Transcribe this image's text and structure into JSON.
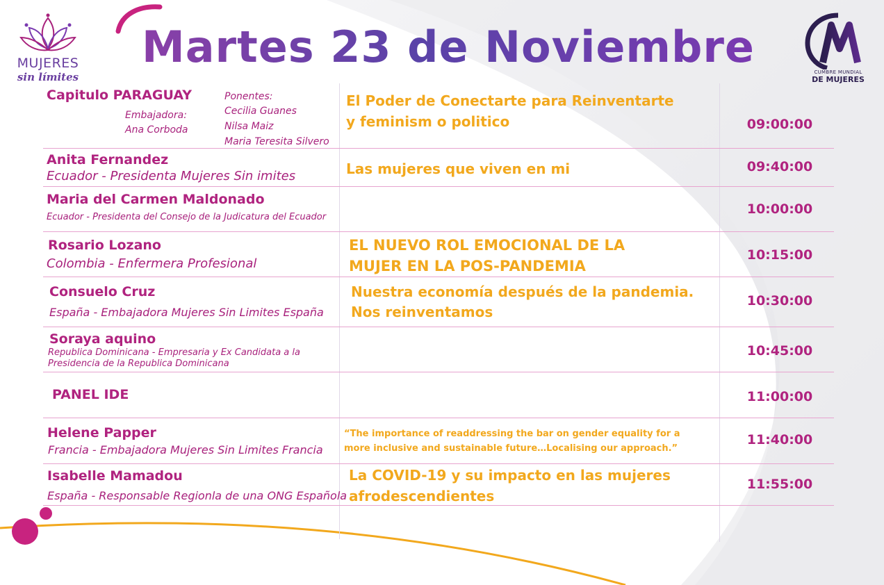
{
  "header": {
    "title": "Martes 23 de Noviembre",
    "logo_left": {
      "line1": "MUJERES",
      "line2": "sin límites"
    },
    "logo_right": {
      "letter": "M",
      "line1": "CUMBRE MUNDIAL",
      "line2": "DE MUJERES"
    }
  },
  "colors": {
    "accent_purple": "#5a43a8",
    "magenta": "#b0237f",
    "orange": "#f2a81d",
    "pink_line": "#e7a3cf"
  },
  "rows": [
    {
      "name": "Capitulo PARAGUAY",
      "ambassador_label": "Embajadora:",
      "ambassador": "Ana Corboda",
      "speakers_label": "Ponentes:",
      "speakers": [
        "Cecilia Guanes",
        "Nilsa Maiz",
        "Maria Teresita Silvero"
      ],
      "topic_lines": [
        "El Poder de Conectarte para Reinventarte",
        "y feminism o politico"
      ],
      "time": "09:00:00"
    },
    {
      "name": "Anita Fernandez",
      "subtitle": "Ecuador - Presidenta Mujeres Sin imites",
      "topic_lines": [
        "Las mujeres que viven en mi"
      ],
      "time": "09:40:00"
    },
    {
      "name": "Maria del Carmen Maldonado",
      "subtitle": "Ecuador - Presidenta del Consejo de la Judicatura del Ecuador",
      "topic_lines": [],
      "time": "10:00:00"
    },
    {
      "name": "Rosario Lozano",
      "subtitle": "Colombia - Enfermera Profesional",
      "topic_lines": [
        "EL NUEVO ROL EMOCIONAL DE LA",
        "MUJER EN LA POS-PANDEMIA"
      ],
      "time": "10:15:00"
    },
    {
      "name": "Consuelo Cruz",
      "subtitle": "España - Embajadora Mujeres Sin Limites España",
      "topic_lines": [
        "Nuestra economía después de la pandemia.",
        "Nos reinventamos"
      ],
      "time": "10:30:00"
    },
    {
      "name": "Soraya aquino",
      "subtitle_lines": [
        "Republica Dominicana - Empresaria y Ex Candidata a la",
        "Presidencia de la Republica Dominicana"
      ],
      "topic_lines": [],
      "time": "10:45:00"
    },
    {
      "name": "PANEL IDE",
      "topic_lines": [],
      "time": "11:00:00"
    },
    {
      "name": "Helene Papper",
      "subtitle": "Francia - Embajadora Mujeres Sin Limites Francia",
      "topic_lines": [
        "“The importance of readdressing the bar on gender equality for a",
        "more inclusive and sustainable future…Localising our approach.”"
      ],
      "time": "11:40:00"
    },
    {
      "name": "Isabelle Mamadou",
      "subtitle": "España - Responsable Regionla de una ONG Española",
      "topic_lines": [
        "La COVID-19 y su impacto en las mujeres",
        "afrodescendientes"
      ],
      "time": "11:55:00"
    }
  ]
}
